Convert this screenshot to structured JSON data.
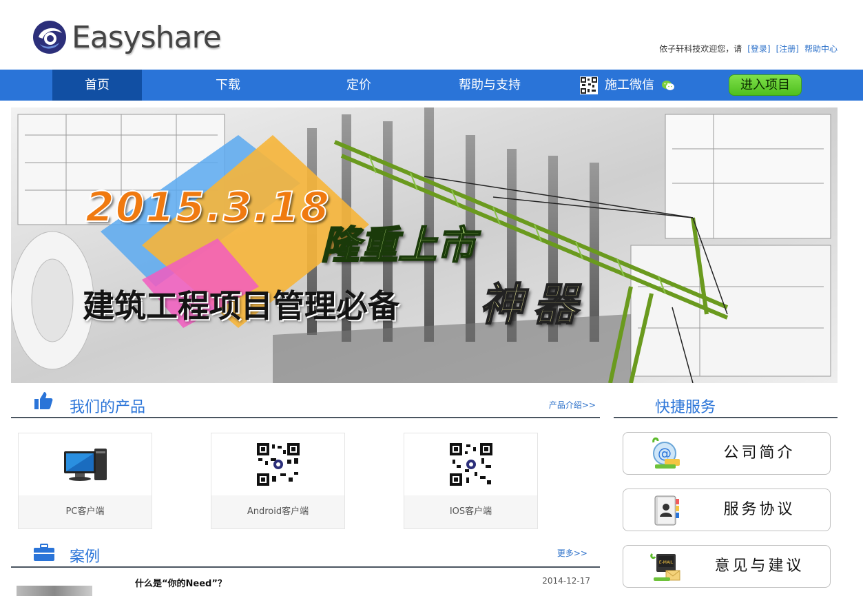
{
  "header": {
    "logo_text": "Easyshare",
    "welcome": "依子轩科技欢迎您，请",
    "login": "[登录]",
    "register": "[注册]",
    "help": "帮助中心"
  },
  "nav": {
    "items": [
      {
        "label": "首页",
        "active": true
      },
      {
        "label": "下载"
      },
      {
        "label": "定价"
      },
      {
        "label": "帮助与支持"
      },
      {
        "label": "施工微信"
      }
    ],
    "enter_project": "进入项目"
  },
  "banner": {
    "date": "2015.3.18",
    "launch": "隆重上市",
    "slogan": "建筑工程项目管理必备",
    "highlight": "神器"
  },
  "products": {
    "title": "我们的产品",
    "more": "产品介绍>>",
    "items": [
      {
        "label": "PC客户端",
        "icon": "monitor-icon"
      },
      {
        "label": "Android客户端",
        "icon": "qr-code-icon"
      },
      {
        "label": "IOS客户端",
        "icon": "qr-code-icon"
      }
    ]
  },
  "services": {
    "title": "快捷服务",
    "items": [
      {
        "label": "公司简介",
        "icon": "email-globe-icon"
      },
      {
        "label": "服务协议",
        "icon": "address-book-icon"
      },
      {
        "label": "意见与建议",
        "icon": "mail-feedback-icon"
      }
    ]
  },
  "cases": {
    "title": "案例",
    "more": "更多>>",
    "items": [
      {
        "title": "什么是“你的Need”？",
        "date": "2014-12-17"
      }
    ]
  },
  "colors": {
    "nav_bg": "#2a74d8",
    "nav_active": "#114fa3",
    "accent_green": "#5fcb2a",
    "title_blue": "#2a74d8"
  }
}
